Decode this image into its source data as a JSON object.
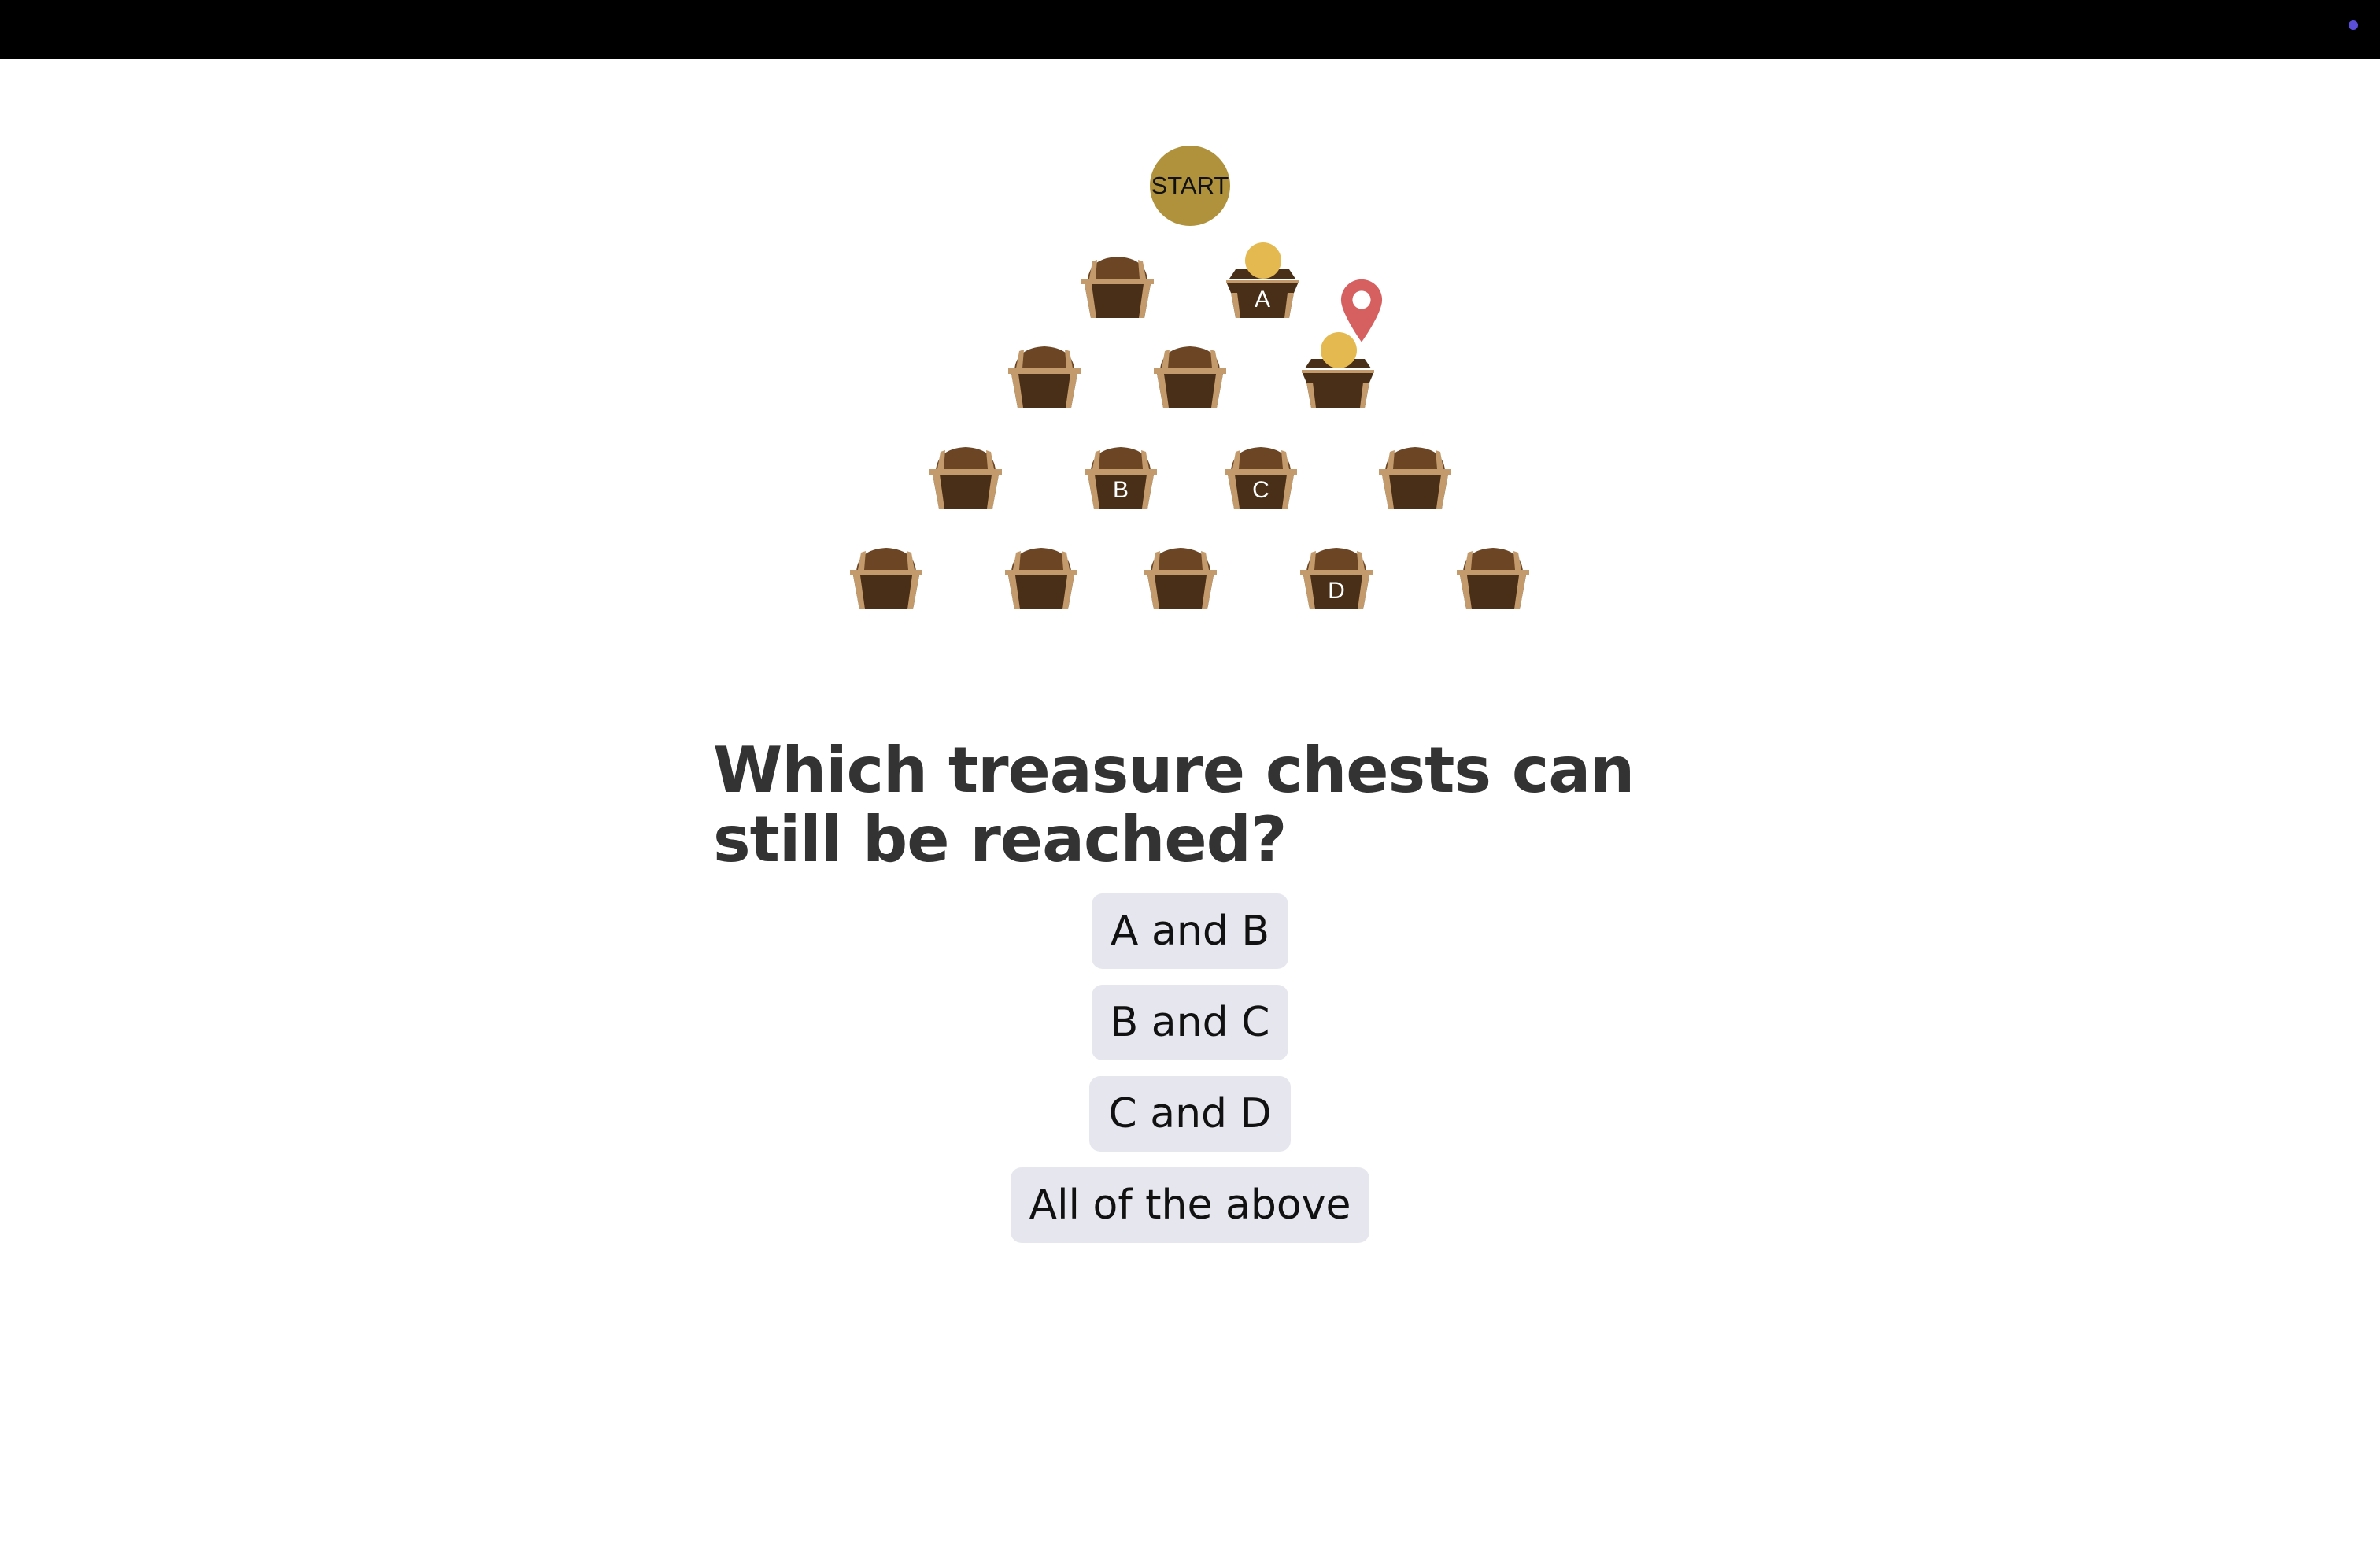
{
  "colors": {
    "topbar": "#000000",
    "indicator_dot": "#5b4fd9",
    "start_circle": "#b0923d",
    "coin": "#e4b94f",
    "pin": "#d66060",
    "chest_body": "#4a2f18",
    "chest_lid": "#6b4524",
    "chest_trim": "#c29a6b",
    "option_bg": "#e6e6ee",
    "question_text": "#333333"
  },
  "board": {
    "start_label": "START",
    "rows": [
      [
        {
          "label": "",
          "coin": false,
          "pin": false,
          "open": false
        },
        {
          "label": "A",
          "coin": true,
          "pin": false,
          "open": true
        }
      ],
      [
        {
          "label": "",
          "coin": false,
          "pin": false,
          "open": false
        },
        {
          "label": "",
          "coin": false,
          "pin": false,
          "open": false
        },
        {
          "label": "",
          "coin": true,
          "pin": true,
          "open": true
        }
      ],
      [
        {
          "label": "",
          "coin": false,
          "pin": false,
          "open": false
        },
        {
          "label": "B",
          "coin": false,
          "pin": false,
          "open": false
        },
        {
          "label": "C",
          "coin": false,
          "pin": false,
          "open": false
        },
        {
          "label": "",
          "coin": false,
          "pin": false,
          "open": false
        }
      ],
      [
        {
          "label": "",
          "coin": false,
          "pin": false,
          "open": false
        },
        {
          "label": "",
          "coin": false,
          "pin": false,
          "open": false
        },
        {
          "label": "",
          "coin": false,
          "pin": false,
          "open": false
        },
        {
          "label": "D",
          "coin": false,
          "pin": false,
          "open": false
        },
        {
          "label": "",
          "coin": false,
          "pin": false,
          "open": false
        }
      ]
    ]
  },
  "question": "Which treasure chests can still be reached?",
  "options": [
    {
      "label": "A and B"
    },
    {
      "label": "B and C"
    },
    {
      "label": "C and D"
    },
    {
      "label": "All of the above"
    }
  ]
}
